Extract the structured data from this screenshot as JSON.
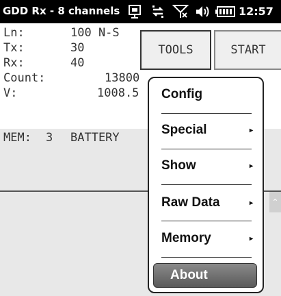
{
  "statusbar": {
    "title": "GDD Rx - 8 channels",
    "time": "12:57",
    "icons": [
      "sync-device-icon",
      "data-connection-icon",
      "no-signal-icon",
      "volume-icon",
      "battery-icon"
    ]
  },
  "readings": {
    "ln_label": "Ln:",
    "ln_value": "100 N-S",
    "tx_label": "Tx:",
    "tx_value": "30",
    "rx_label": "Rx:",
    "rx_value": "40",
    "count_label": "Count:",
    "count_value": "13800",
    "v_label": "V:",
    "v_value": "1008.5"
  },
  "buttons": {
    "tools": "TOOLS",
    "start": "START"
  },
  "status": {
    "mem_label": "MEM:",
    "mem_value": "3",
    "battery_label": "BATTERY"
  },
  "menu": {
    "items": [
      {
        "label": "Config",
        "has_submenu": false
      },
      {
        "label": "Special",
        "has_submenu": true
      },
      {
        "label": "Show",
        "has_submenu": true
      },
      {
        "label": "Raw Data",
        "has_submenu": true
      },
      {
        "label": "Memory",
        "has_submenu": true
      },
      {
        "label": "About",
        "has_submenu": false,
        "highlighted": true
      }
    ],
    "submenu_glyph": "▸"
  },
  "colors": {
    "statusbar_bg": "#000000",
    "panel_bg": "#e8e8e8",
    "highlight": "#707070"
  }
}
